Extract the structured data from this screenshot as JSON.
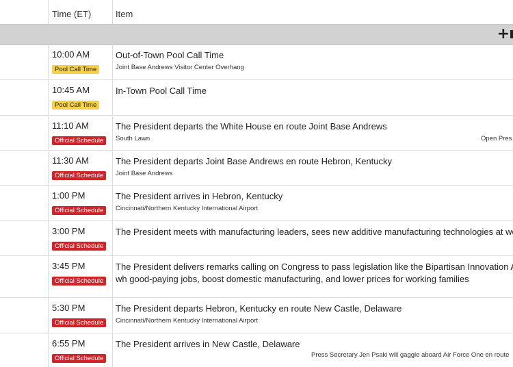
{
  "header": {
    "time_col": "Time (ET)",
    "item_col": "Item"
  },
  "toolbar": {
    "add_icon": "plus-icon"
  },
  "colors": {
    "pool_badge": "#f5d04a",
    "official_badge": "#d0232a",
    "toolbar_band": "#d2d2d2"
  },
  "rows": [
    {
      "time": "10:00 AM",
      "badge": "Pool Call Time",
      "title": "Out-of-Town Pool Call Time",
      "location": "Joint Base Andrews Visitor Center Overhang"
    },
    {
      "time": "10:45 AM",
      "badge": "Pool Call Time",
      "title": "In-Town Pool Call Time",
      "location": ""
    },
    {
      "time": "11:10 AM",
      "badge": "Official Schedule",
      "title": "The President departs the White House en route Joint Base Andrews",
      "location": "South Lawn",
      "note": "Open Pres"
    },
    {
      "time": "11:30 AM",
      "badge": "Official Schedule",
      "title": "The President departs Joint Base Andrews en route Hebron, Kentucky",
      "location": "Joint Base Andrews"
    },
    {
      "time": "1:00 PM",
      "badge": "Official Schedule",
      "title": "The President arrives in Hebron, Kentucky",
      "location": "Cincinnati/Northern Kentucky International Airport"
    },
    {
      "time": "3:00 PM",
      "badge": "Official Schedule",
      "title": "The President meets with manufacturing leaders, sees new additive manufacturing technologies at work",
      "location": ""
    },
    {
      "time": "3:45 PM",
      "badge": "Official Schedule",
      "title": "The President delivers remarks calling on Congress to pass legislation like the Bipartisan Innovation Act, wh good-paying jobs, boost domestic manufacturing, and lower prices for working families",
      "location": ""
    },
    {
      "time": "5:30 PM",
      "badge": "Official Schedule",
      "title": "The President departs Hebron, Kentucky en route New Castle, Delaware",
      "location": "Cincinnati/Northern Kentucky International Airport"
    },
    {
      "time": "6:55 PM",
      "badge": "Official Schedule",
      "title": "The President arrives in New Castle, Delaware",
      "location": "",
      "note": "Press Secretary Jen Psaki will gaggle aboard Air Force One en route"
    }
  ]
}
